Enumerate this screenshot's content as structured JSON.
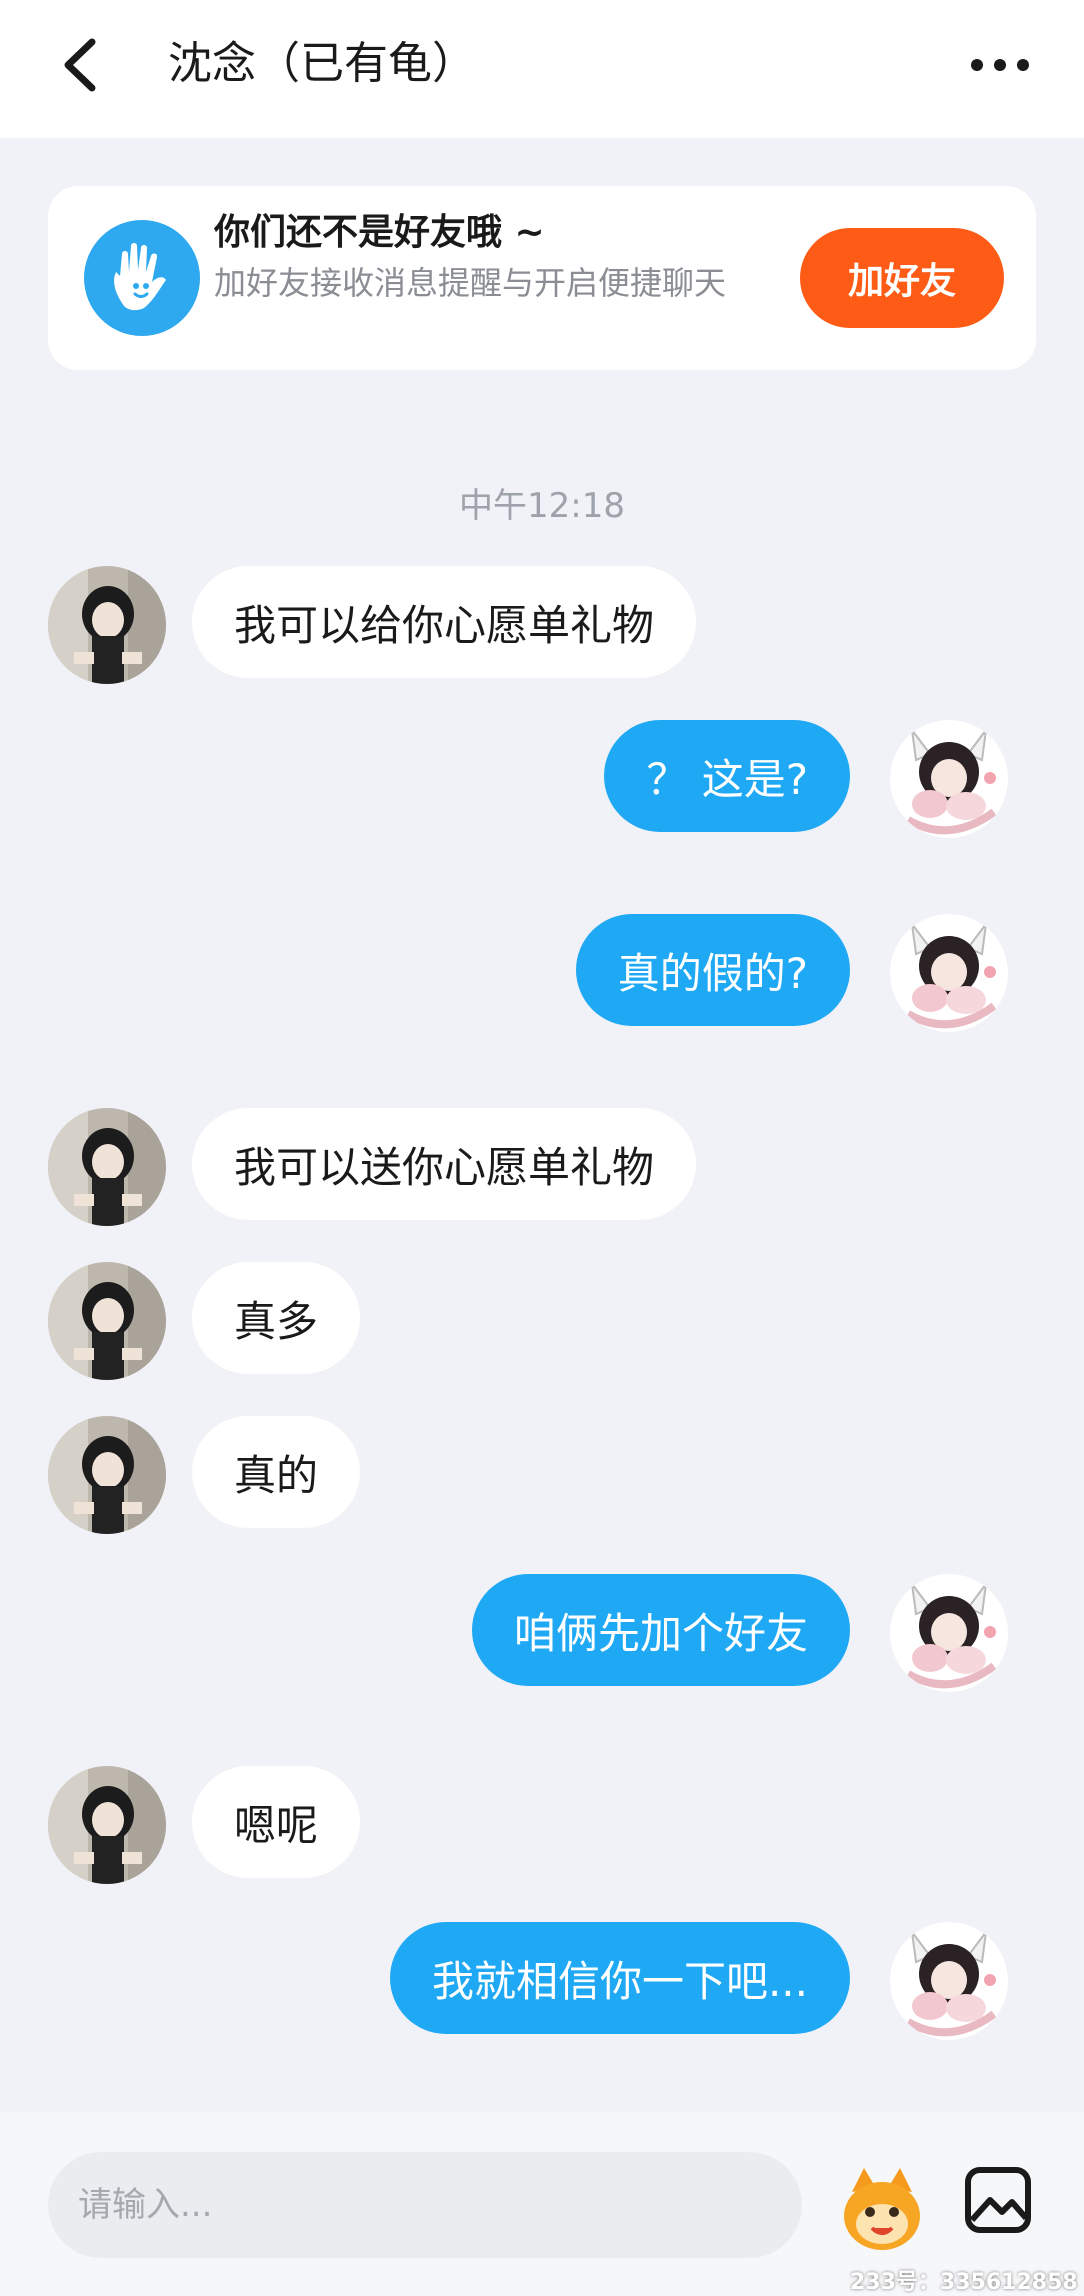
{
  "header": {
    "title": "沈念（已有龟）",
    "back_icon": "chevron-left-icon",
    "more_icon": "more-horizontal-icon"
  },
  "friend_card": {
    "title": "你们还不是好友哦 ~",
    "subtitle": "加好友接收消息提醒与开启便捷聊天",
    "button": "加好友",
    "icon": "hand-icon"
  },
  "timestamp": "中午12:18",
  "messages": [
    {
      "side": "left",
      "text": "我可以给你心愿单礼物"
    },
    {
      "side": "right",
      "text": "？ 这是?"
    },
    {
      "side": "right",
      "text": "真的假的?"
    },
    {
      "side": "left",
      "text": "我可以送你心愿单礼物"
    },
    {
      "side": "left",
      "text": "真多"
    },
    {
      "side": "left",
      "text": "真的"
    },
    {
      "side": "right",
      "text": "咱俩先加个好友"
    },
    {
      "side": "left",
      "text": "嗯呢"
    },
    {
      "side": "right",
      "text": "我就相信你一下吧..."
    }
  ],
  "input": {
    "placeholder": "请输入..."
  },
  "watermark": "233号：335612858",
  "colors": {
    "accent_blue": "#1fa9f4",
    "button_orange": "#fe5b16",
    "background": "#f0f2f7"
  }
}
